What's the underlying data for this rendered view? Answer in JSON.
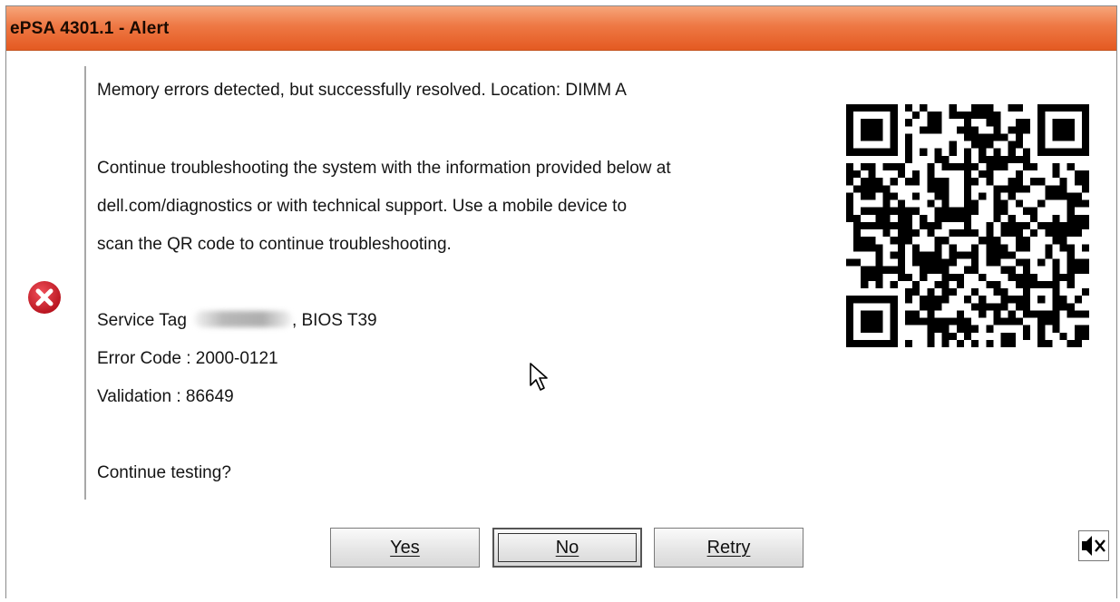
{
  "window": {
    "title": "ePSA 4301.1 - Alert",
    "accent_color": "#e86330"
  },
  "alert": {
    "icon": "error-x-icon",
    "line1": "Memory errors detected, but successfully resolved. Location: DIMM A",
    "paragraph_lines": [
      "Continue troubleshooting the system with the information provided below at",
      "dell.com/diagnostics or with technical support.  Use a mobile device to",
      "scan the QR code to continue troubleshooting."
    ],
    "service_tag_label": "Service Tag",
    "bios_text": ", BIOS T39",
    "error_code": "Error Code : 2000-0121",
    "validation": "Validation : 86649",
    "prompt": "Continue testing?"
  },
  "qr": {
    "icon": "qr-code-icon"
  },
  "buttons": {
    "yes": "Yes",
    "no": "No",
    "retry": "Retry"
  },
  "mute": {
    "icon": "speaker-mute-icon"
  }
}
